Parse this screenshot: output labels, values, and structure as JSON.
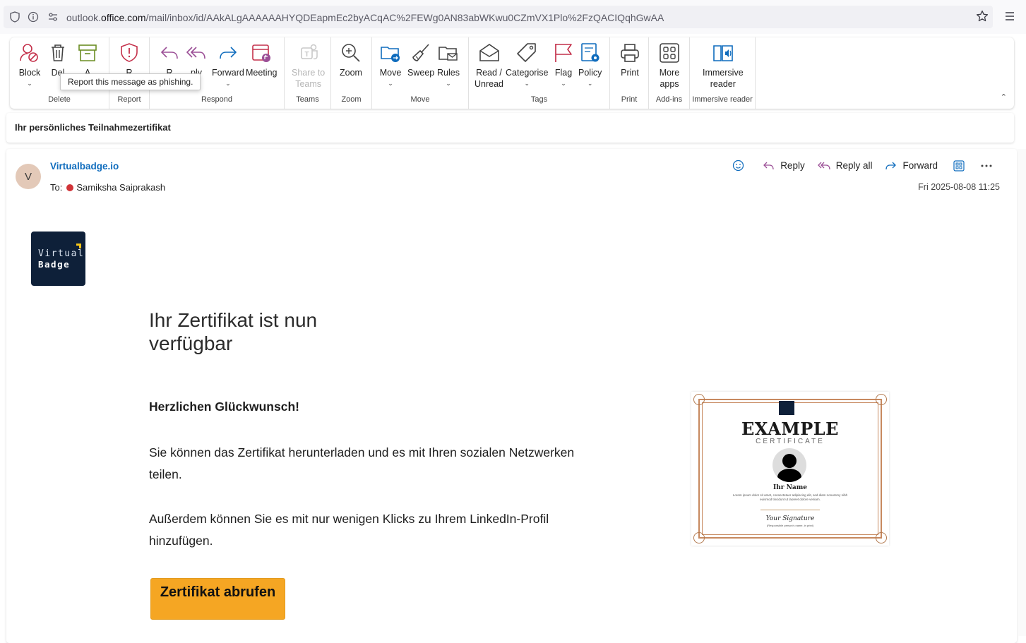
{
  "browser": {
    "url_prefix": "outlook.",
    "url_domain": "office.com",
    "url_path": "/mail/inbox/id/AAkALgAAAAAAHYQDEapmEc2byACqAC%2FEWg0AN83abWKwu0CZmVX1Plo%2FzQACIQqhGwAA"
  },
  "ribbon": {
    "groups": {
      "delete": "Delete",
      "report": "Report",
      "respond": "Respond",
      "teams": "Teams",
      "zoom": "Zoom",
      "move": "Move",
      "tags": "Tags",
      "print": "Print",
      "addins": "Add-ins",
      "immersive": "Immersive reader"
    },
    "buttons": {
      "block": "Block",
      "delete": "Del",
      "archive": "A",
      "report": "R",
      "reply": "R",
      "reply_all": "ply",
      "forward": "Forward",
      "meeting": "Meeting",
      "share_teams_1": "Share to",
      "share_teams_2": "Teams",
      "zoom": "Zoom",
      "move": "Move",
      "sweep": "Sweep",
      "rules": "Rules",
      "read_unread_1": "Read /",
      "read_unread_2": "Unread",
      "categorise": "Categorise",
      "flag": "Flag",
      "policy": "Policy",
      "print": "Print",
      "more_apps_1": "More",
      "more_apps_2": "apps",
      "immersive_1": "Immersive",
      "immersive_2": "reader"
    },
    "tooltip": "Report this message as phishing."
  },
  "subject": "Ihr persönliches Teilnahmezertifikat",
  "message": {
    "avatar_initial": "V",
    "sender": "Virtualbadge.io",
    "to_label": "To:",
    "recipient": "Samiksha Saiprakash",
    "date": "Fri 2025-08-08 11:25",
    "actions": {
      "reply": "Reply",
      "reply_all": "Reply all",
      "forward": "Forward"
    }
  },
  "body": {
    "logo_line1": "Virtual",
    "logo_line2": "Badge",
    "headline": "Ihr Zertifikat ist nun verfügbar",
    "congrats": "Herzlichen Glückwunsch!",
    "para1": "Sie können das Zertifikat herunterladen und es mit Ihren sozialen Netzwerken teilen.",
    "para2": "Außerdem können Sie es mit nur wenigen Klicks zu Ihrem LinkedIn-Profil hinzufügen.",
    "cta": "Zertifikat abrufen"
  },
  "certificate": {
    "title": "EXAMPLE",
    "subtitle": "CERTIFICATE",
    "name": "Ihr Name",
    "lorem": "Lorem ipsum dolor sit amet, consectetuer adipiscing elit, sed diam nonummy nibh euismod tincidunt ut laoreet dolore veniam.",
    "signature": "Your Signature",
    "signature_caption": "(Responsible person's name, in print)"
  },
  "colors": {
    "accent": "#0f6cbd",
    "cta": "#f5a623",
    "logo_bg": "#0e2039",
    "presence": "#d13438"
  }
}
